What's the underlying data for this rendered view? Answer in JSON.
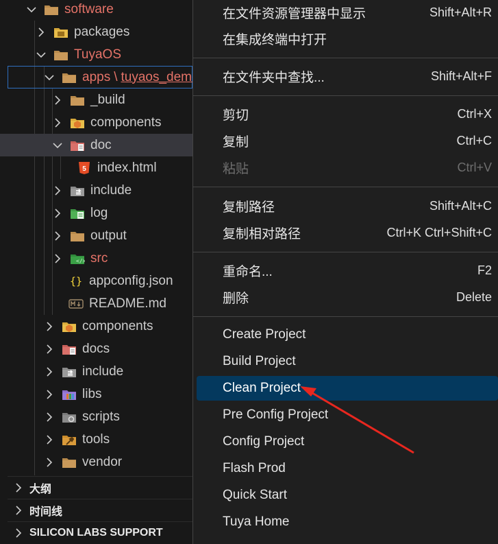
{
  "explorer": {
    "tree": [
      {
        "label": "software",
        "kind": "folder",
        "color": "red",
        "expanded": true
      },
      {
        "label": "packages",
        "kind": "folder-yellow",
        "color": "",
        "expanded": false
      },
      {
        "label": "TuyaOS",
        "kind": "folder",
        "color": "red",
        "expanded": true
      },
      {
        "label_prefix": "apps",
        "separator": "\\",
        "label": "tuyaos_demo",
        "kind": "folder",
        "color": "red",
        "expanded": true
      },
      {
        "label": "_build",
        "kind": "folder",
        "color": "",
        "expanded": false
      },
      {
        "label": "components",
        "kind": "folder-components",
        "color": "",
        "expanded": false
      },
      {
        "label": "doc",
        "kind": "folder-doc",
        "color": "",
        "expanded": true
      },
      {
        "label": "index.html",
        "kind": "html-file",
        "color": ""
      },
      {
        "label": "include",
        "kind": "folder-include",
        "color": "",
        "expanded": false
      },
      {
        "label": "log",
        "kind": "folder-log",
        "color": "",
        "expanded": false
      },
      {
        "label": "output",
        "kind": "folder",
        "color": "",
        "expanded": false
      },
      {
        "label": "src",
        "kind": "folder-src",
        "color": "red",
        "expanded": false
      },
      {
        "label": "appconfig.json",
        "kind": "json-file",
        "color": ""
      },
      {
        "label": "README.md",
        "kind": "md-file",
        "color": ""
      },
      {
        "label": "components",
        "kind": "folder-components",
        "color": "",
        "expanded": false
      },
      {
        "label": "docs",
        "kind": "folder-doc",
        "color": "",
        "expanded": false
      },
      {
        "label": "include",
        "kind": "folder-include",
        "color": "",
        "expanded": false
      },
      {
        "label": "libs",
        "kind": "folder-libs",
        "color": "",
        "expanded": false
      },
      {
        "label": "scripts",
        "kind": "folder-scripts",
        "color": "",
        "expanded": false
      },
      {
        "label": "tools",
        "kind": "folder-tools",
        "color": "",
        "expanded": false
      },
      {
        "label": "vendor",
        "kind": "folder",
        "color": "",
        "expanded": false
      }
    ],
    "sections": [
      {
        "label": "大纲"
      },
      {
        "label": "时间线"
      },
      {
        "label": "SILICON LABS SUPPORT"
      }
    ]
  },
  "context_menu": {
    "items": [
      {
        "label": "在文件资源管理器中显示",
        "shortcut": "Shift+Alt+R"
      },
      {
        "label": "在集成终端中打开",
        "shortcut": ""
      },
      {
        "label": "在文件夹中查找...",
        "shortcut": "Shift+Alt+F"
      },
      {
        "label": "剪切",
        "shortcut": "Ctrl+X"
      },
      {
        "label": "复制",
        "shortcut": "Ctrl+C"
      },
      {
        "label": "粘贴",
        "shortcut": "Ctrl+V",
        "disabled": true
      },
      {
        "label": "复制路径",
        "shortcut": "Shift+Alt+C"
      },
      {
        "label": "复制相对路径",
        "shortcut": "Ctrl+K Ctrl+Shift+C"
      },
      {
        "label": "重命名...",
        "shortcut": "F2"
      },
      {
        "label": "删除",
        "shortcut": "Delete"
      },
      {
        "label": "Create Project",
        "shortcut": ""
      },
      {
        "label": "Build Project",
        "shortcut": ""
      },
      {
        "label": "Clean Project",
        "shortcut": "",
        "active": true
      },
      {
        "label": "Pre Config Project",
        "shortcut": ""
      },
      {
        "label": "Config Project",
        "shortcut": ""
      },
      {
        "label": "Flash Prod",
        "shortcut": ""
      },
      {
        "label": "Quick Start",
        "shortcut": ""
      },
      {
        "label": "Tuya Home",
        "shortcut": ""
      }
    ]
  },
  "colors": {
    "accent_selected": "#04395e",
    "git_modified_red": "#e57368",
    "annotation_arrow": "#e8271f"
  }
}
